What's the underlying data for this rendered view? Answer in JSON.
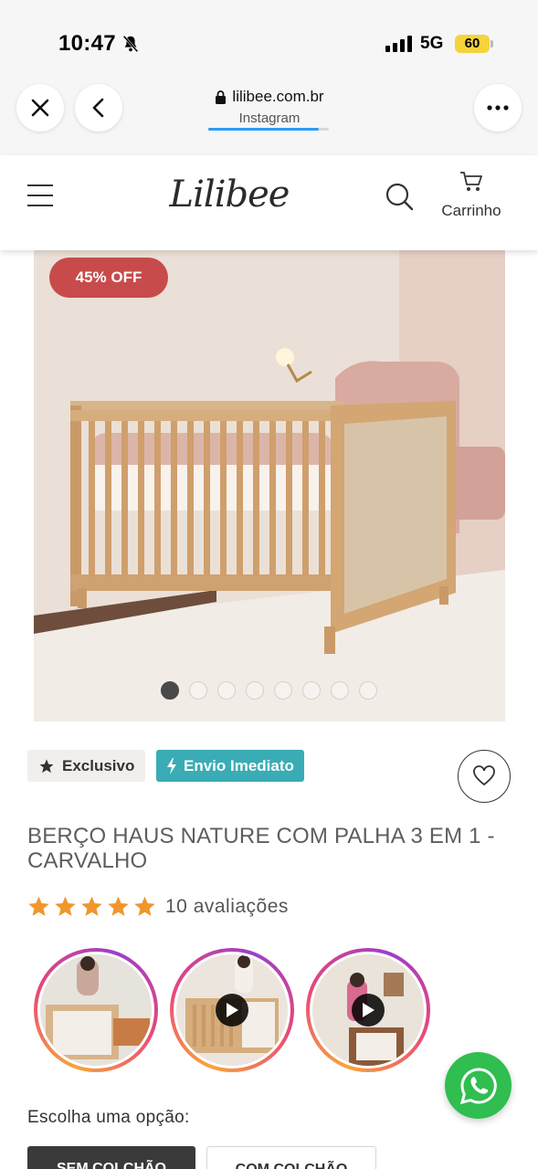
{
  "status_bar": {
    "time": "10:47",
    "network": "5G",
    "battery": "60"
  },
  "browser": {
    "domain": "lilibee.com.br",
    "source": "Instagram"
  },
  "header": {
    "logo": "Lilibee",
    "cart_label": "Carrinho"
  },
  "gallery": {
    "discount_badge": "45% OFF",
    "image_count": 8,
    "active_index": 0
  },
  "tags": {
    "exclusive": "Exclusivo",
    "shipping": "Envio Imediato"
  },
  "product": {
    "title": "BERÇO HAUS NATURE COM PALHA 3 EM 1 - CARVALHO",
    "rating": 5,
    "reviews_label": "10 avaliações"
  },
  "stories": [
    {
      "has_play": false
    },
    {
      "has_play": true
    },
    {
      "has_play": true
    }
  ],
  "options": {
    "label": "Escolha uma opção:",
    "items": [
      "SEM COLCHÃO",
      "COM COLCHÃO"
    ]
  },
  "colors": {
    "accent_red": "#c84b4b",
    "shipping_teal": "#3aacb5",
    "star": "#f0962c",
    "whatsapp": "#2fbe4f"
  }
}
